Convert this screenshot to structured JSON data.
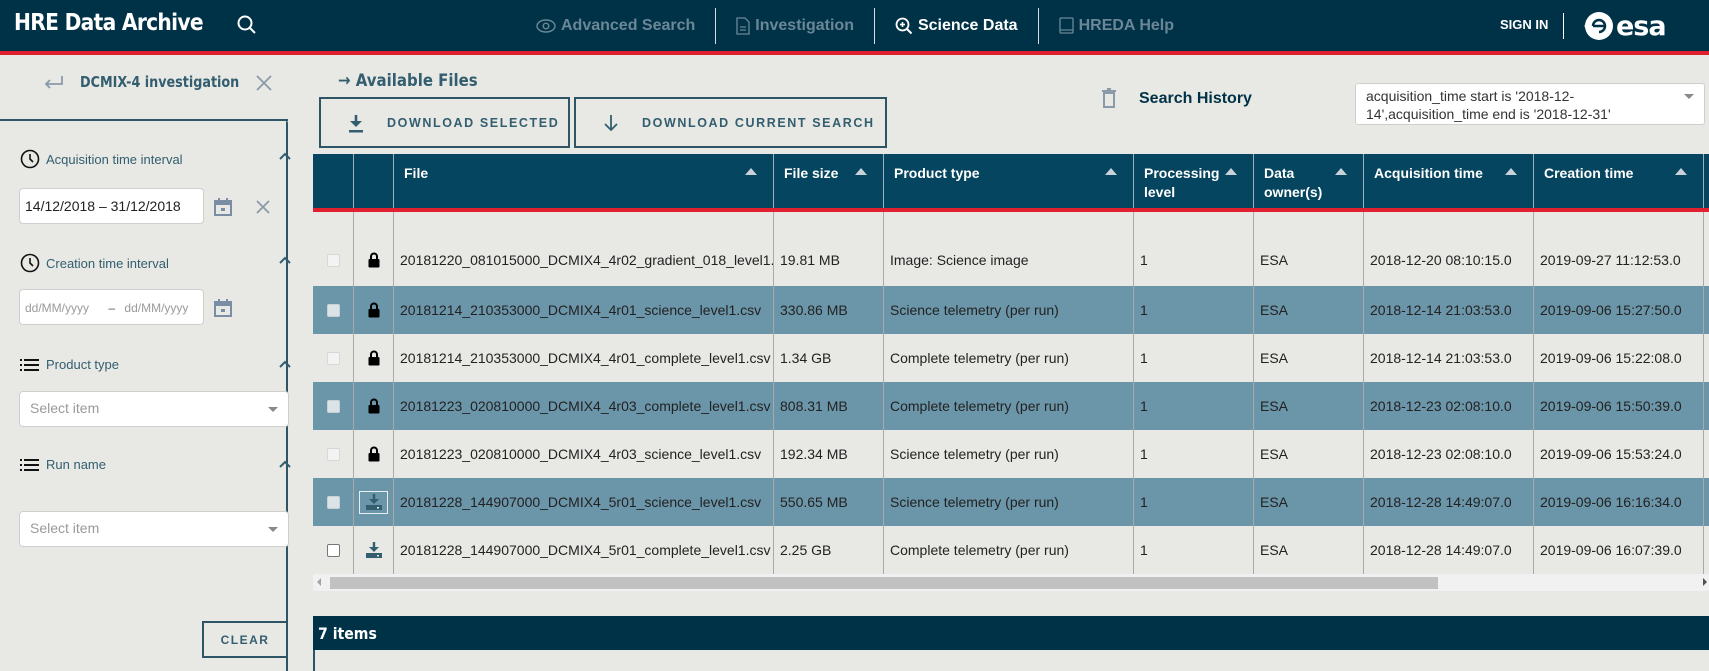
{
  "app": {
    "title": "HRE  Data Archive",
    "nav": [
      {
        "label": "Advanced Search",
        "icon": "eye-icon",
        "active": false
      },
      {
        "label": "Investigation",
        "icon": "document-icon",
        "active": false
      },
      {
        "label": "Science Data",
        "icon": "zoom-in-icon",
        "active": true
      },
      {
        "label": "HREDA Help",
        "icon": "book-icon",
        "active": false
      }
    ],
    "sign_in": "SIGN IN",
    "logo": "esa"
  },
  "sidebar": {
    "title": "DCMIX-4 investigation",
    "filters": {
      "acquisition": {
        "label": "Acquisition time interval",
        "value": "14/12/2018 – 31/12/2018"
      },
      "creation": {
        "label": "Creation time interval",
        "start_placeholder": "dd/MM/yyyy",
        "separator": "–",
        "end_placeholder": "dd/MM/yyyy"
      },
      "product_type": {
        "label": "Product type",
        "placeholder": "Select item"
      },
      "run_name": {
        "label": "Run name",
        "placeholder": "Select item"
      }
    },
    "clear_label": "CLEAR"
  },
  "main": {
    "section_title": "→ Available Files",
    "download_selected": "DOWNLOAD SELECTED",
    "download_current_search": "DOWNLOAD CURRENT SEARCH",
    "search_history_label": "Search History",
    "search_history_value": "acquisition_time start is '2018-12-14',acquisition_time end is '2018-12-31'",
    "table": {
      "columns": [
        "File",
        "File size",
        "Product type",
        "Processing level",
        "Data owner(s)",
        "Acquisition time",
        "Creation time"
      ],
      "rows": [
        {
          "access": "locked",
          "file": "20181220_081015000_DCMIX4_4r02_gradient_018_level1.",
          "size": "19.81 MB",
          "product_type": "Image: Science image",
          "level": "1",
          "owner": "ESA",
          "acquisition": "2018-12-20 08:10:15.0",
          "creation": "2019-09-27 11:12:53.0"
        },
        {
          "access": "locked",
          "file": "20181214_210353000_DCMIX4_4r01_science_level1.csv",
          "size": "330.86 MB",
          "product_type": "Science telemetry (per run)",
          "level": "1",
          "owner": "ESA",
          "acquisition": "2018-12-14 21:03:53.0",
          "creation": "2019-09-06 15:27:50.0"
        },
        {
          "access": "locked",
          "file": "20181214_210353000_DCMIX4_4r01_complete_level1.csv",
          "size": "1.34 GB",
          "product_type": "Complete telemetry (per run)",
          "level": "1",
          "owner": "ESA",
          "acquisition": "2018-12-14 21:03:53.0",
          "creation": "2019-09-06 15:22:08.0"
        },
        {
          "access": "locked",
          "file": "20181223_020810000_DCMIX4_4r03_complete_level1.csv",
          "size": "808.31 MB",
          "product_type": "Complete telemetry (per run)",
          "level": "1",
          "owner": "ESA",
          "acquisition": "2018-12-23 02:08:10.0",
          "creation": "2019-09-06 15:50:39.0"
        },
        {
          "access": "locked",
          "file": "20181223_020810000_DCMIX4_4r03_science_level1.csv",
          "size": "192.34 MB",
          "product_type": "Science telemetry (per run)",
          "level": "1",
          "owner": "ESA",
          "acquisition": "2018-12-23 02:08:10.0",
          "creation": "2019-09-06 15:53:24.0"
        },
        {
          "access": "download",
          "file": "20181228_144907000_DCMIX4_5r01_science_level1.csv",
          "size": "550.65 MB",
          "product_type": "Science telemetry (per run)",
          "level": "1",
          "owner": "ESA",
          "acquisition": "2018-12-28 14:49:07.0",
          "creation": "2019-09-06 16:16:34.0"
        },
        {
          "access": "download",
          "file": "20181228_144907000_DCMIX4_5r01_complete_level1.csv",
          "size": "2.25 GB",
          "product_type": "Complete telemetry (per run)",
          "level": "1",
          "owner": "ESA",
          "acquisition": "2018-12-28 14:49:07.0",
          "creation": "2019-09-06 16:07:39.0"
        }
      ]
    },
    "items_count": "7 items"
  },
  "colors": {
    "navbar": "#003247",
    "accent_red": "#e0202f",
    "table_header": "#05455f",
    "row_highlight": "#6b95a8",
    "text_teal": "#335e6f"
  }
}
